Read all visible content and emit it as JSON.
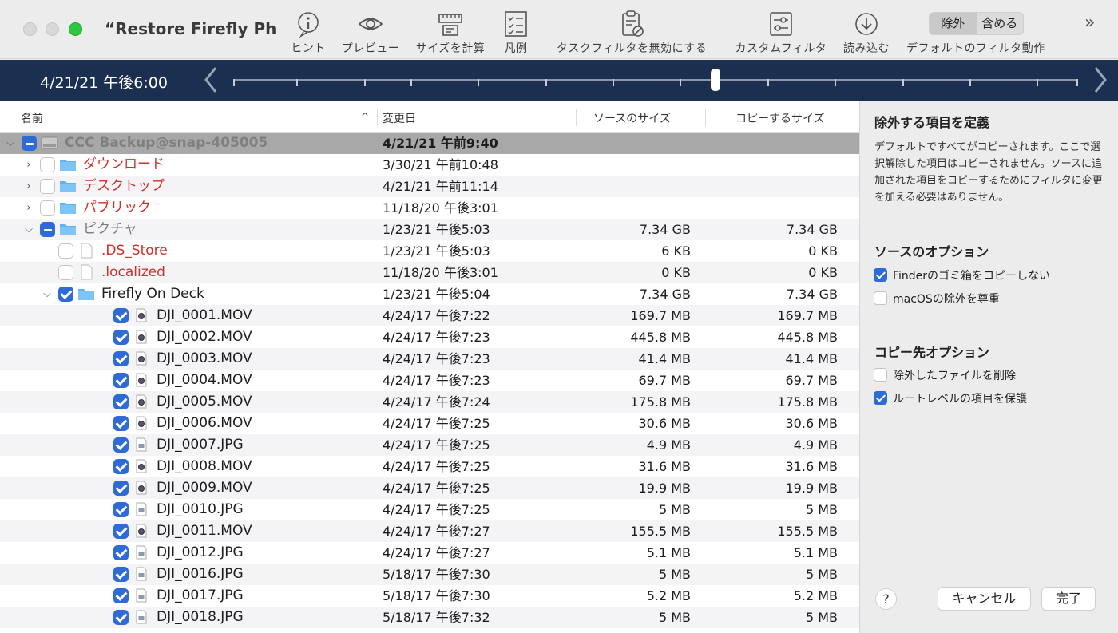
{
  "window": {
    "title": "“Restore Firefly Ph..."
  },
  "toolbar": {
    "items": [
      {
        "label": "ヒント",
        "icon": "hint-icon"
      },
      {
        "label": "プレビュー",
        "icon": "eye-icon"
      },
      {
        "label": "サイズを計算",
        "icon": "ruler-icon"
      },
      {
        "label": "凡例",
        "icon": "legend-icon"
      },
      {
        "label": "タスクフィルタを無効にする",
        "icon": "clipboard-disable-icon"
      },
      {
        "label": "カスタムフィルタ",
        "icon": "filter-sliders-icon"
      },
      {
        "label": "読み込む",
        "icon": "download-icon"
      }
    ],
    "segment": {
      "exclude": "除外",
      "include": "含める",
      "label": "デフォルトのフィルタ動作"
    },
    "more": "»"
  },
  "timeline": {
    "date": "4/21/21 午後6:00"
  },
  "columns": {
    "name": "名前",
    "sort_indicator": "^",
    "modified": "変更日",
    "source_size": "ソースのサイズ",
    "copy_size": "コピーするサイズ"
  },
  "rows": [
    {
      "name": "CCC Backup@snap-405005",
      "date": "4/21/21 午前9:40",
      "src": "",
      "copy": ""
    },
    {
      "name": "ダウンロード",
      "date": "3/30/21 午前10:48",
      "src": "",
      "copy": ""
    },
    {
      "name": "デスクトップ",
      "date": "4/21/21 午前11:14",
      "src": "",
      "copy": ""
    },
    {
      "name": "パブリック",
      "date": "11/18/20 午後3:01",
      "src": "",
      "copy": ""
    },
    {
      "name": "ピクチャ",
      "date": "1/23/21 午後5:03",
      "src": "7.34 GB",
      "copy": "7.34 GB"
    },
    {
      "name": ".DS_Store",
      "date": "1/23/21 午後5:03",
      "src": "6 KB",
      "copy": "0 KB"
    },
    {
      "name": ".localized",
      "date": "11/18/20 午後3:01",
      "src": "0 KB",
      "copy": "0 KB"
    },
    {
      "name": "Firefly On Deck",
      "date": "1/23/21 午後5:04",
      "src": "7.34 GB",
      "copy": "7.34 GB"
    },
    {
      "name": "DJI_0001.MOV",
      "date": "4/24/17 午後7:22",
      "src": "169.7 MB",
      "copy": "169.7 MB"
    },
    {
      "name": "DJI_0002.MOV",
      "date": "4/24/17 午後7:23",
      "src": "445.8 MB",
      "copy": "445.8 MB"
    },
    {
      "name": "DJI_0003.MOV",
      "date": "4/24/17 午後7:23",
      "src": "41.4 MB",
      "copy": "41.4 MB"
    },
    {
      "name": "DJI_0004.MOV",
      "date": "4/24/17 午後7:23",
      "src": "69.7 MB",
      "copy": "69.7 MB"
    },
    {
      "name": "DJI_0005.MOV",
      "date": "4/24/17 午後7:24",
      "src": "175.8 MB",
      "copy": "175.8 MB"
    },
    {
      "name": "DJI_0006.MOV",
      "date": "4/24/17 午後7:25",
      "src": "30.6 MB",
      "copy": "30.6 MB"
    },
    {
      "name": "DJI_0007.JPG",
      "date": "4/24/17 午後7:25",
      "src": "4.9 MB",
      "copy": "4.9 MB"
    },
    {
      "name": "DJI_0008.MOV",
      "date": "4/24/17 午後7:25",
      "src": "31.6 MB",
      "copy": "31.6 MB"
    },
    {
      "name": "DJI_0009.MOV",
      "date": "4/24/17 午後7:25",
      "src": "19.9 MB",
      "copy": "19.9 MB"
    },
    {
      "name": "DJI_0010.JPG",
      "date": "4/24/17 午後7:25",
      "src": "5 MB",
      "copy": "5 MB"
    },
    {
      "name": "DJI_0011.MOV",
      "date": "4/24/17 午後7:27",
      "src": "155.5 MB",
      "copy": "155.5 MB"
    },
    {
      "name": "DJI_0012.JPG",
      "date": "4/24/17 午後7:27",
      "src": "5.1 MB",
      "copy": "5.1 MB"
    },
    {
      "name": "DJI_0016.JPG",
      "date": "5/18/17 午後7:30",
      "src": "5 MB",
      "copy": "5 MB"
    },
    {
      "name": "DJI_0017.JPG",
      "date": "5/18/17 午後7:30",
      "src": "5.2 MB",
      "copy": "5.2 MB"
    },
    {
      "name": "DJI_0018.JPG",
      "date": "5/18/17 午後7:32",
      "src": "5 MB",
      "copy": "5 MB"
    }
  ],
  "sidebar": {
    "heading": "除外する項目を定義",
    "description": "デフォルトですべてがコピーされます。ここで選択解除した項目はコピーされません。ソースに追加された項目をコピーするためにフィルタに変更を加える必要はありません。",
    "source_heading": "ソースのオプション",
    "source_opts": [
      {
        "label": "Finderのゴミ箱をコピーしない",
        "checked": true
      },
      {
        "label": "macOSの除外を尊重",
        "checked": false
      }
    ],
    "dest_heading": "コピー先オプション",
    "dest_opts": [
      {
        "label": "除外したファイルを削除",
        "checked": false
      },
      {
        "label": "ルートレベルの項目を保護",
        "checked": true
      }
    ],
    "help": "?",
    "cancel": "キャンセル",
    "done": "完了"
  },
  "colors": {
    "accent": "#2f6bd6",
    "timeline_bg": "#1b3050",
    "excluded_text": "#d0302a",
    "selected_row": "#a8a8a8"
  }
}
